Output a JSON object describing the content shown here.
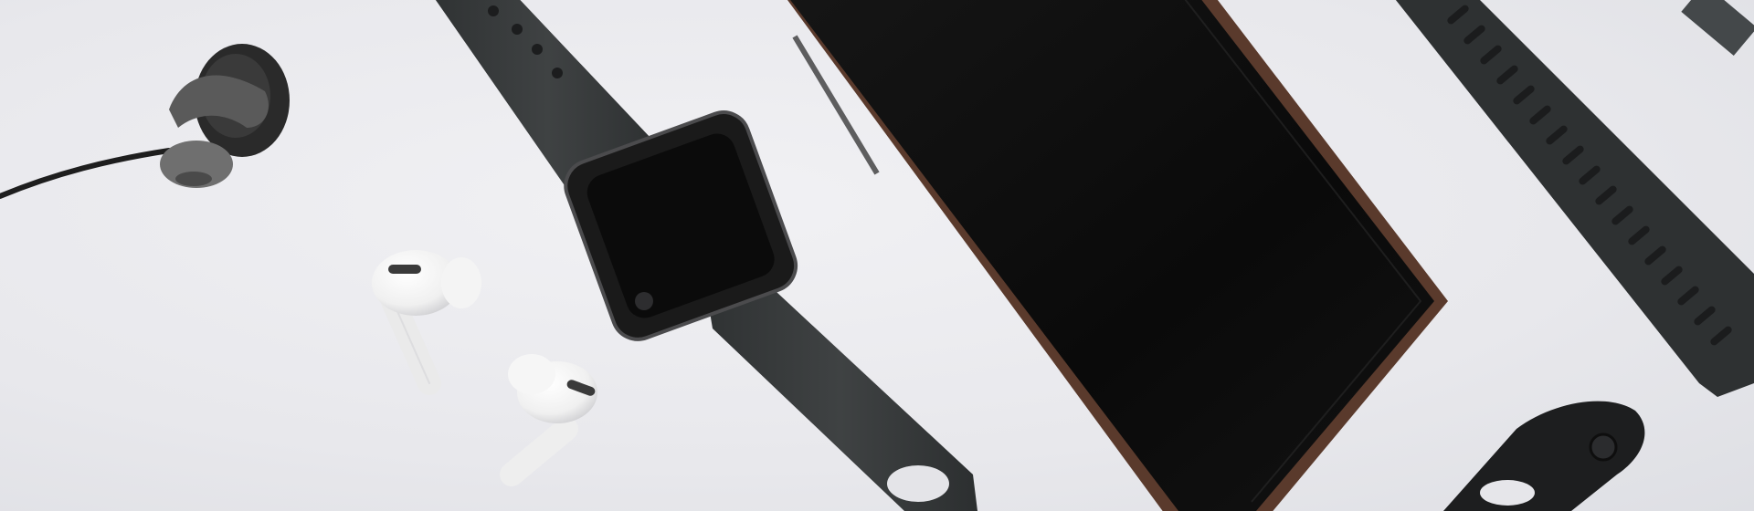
{
  "scene": {
    "description_colors": {
      "surface": "#e9e9ed",
      "device_black": "#111111",
      "strap_gray": "#3b3e3f",
      "phone_frame": "#4a2e22",
      "earbud_white": "#f7f7f7"
    },
    "objects": [
      {
        "name": "wired-earphone",
        "icon": "earphone-icon"
      },
      {
        "name": "smartwatch",
        "icon": "watch-icon"
      },
      {
        "name": "wireless-earbud-left",
        "icon": "earbud-icon"
      },
      {
        "name": "wireless-earbud-right",
        "icon": "earbud-icon"
      },
      {
        "name": "smartphone",
        "icon": "phone-icon"
      },
      {
        "name": "sport-watch-band",
        "icon": "watch-band-icon"
      },
      {
        "name": "watch-band-clasp",
        "icon": "clasp-icon"
      }
    ]
  }
}
